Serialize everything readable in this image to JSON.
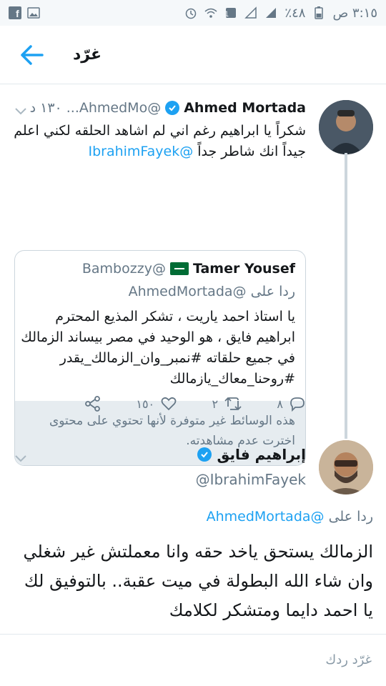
{
  "statusbar": {
    "time": "٣:١٥ ص",
    "battery": "٤٨٪"
  },
  "appbar": {
    "title": "غرّد"
  },
  "tweet1": {
    "name": "Ahmed Mortada",
    "handle": "@AhmedMo...",
    "time": "١٣٠ د",
    "text_line1": "شكراً يا ابراهيم رغم اني لم اشاهد الحلقه لكني اعلم",
    "text_line2": "جيداً انك شاطر جداً",
    "mention": "@IbrahimFayek",
    "quote": {
      "name": "Tamer Yousef",
      "handle": "@Bambozzy",
      "reply_prefix": "ردا على",
      "reply_to": "@AhmedMortada",
      "text": "يا استاذ احمد ياريت ، تشكر المذيع المحترم ابراهيم فايق ، هو الوحيد في مصر بيساند الزمالك في جميع حلقاته #نمبر_وان_الزمالك_يقدر #روحنا_معاك_يازمالك",
      "media_notice": "هذه الوسائط غير متوفرة لأنها تحتوي على محتوى اخترت عدم مشاهدته."
    },
    "actions": {
      "replies": "٨",
      "retweets": "٢",
      "likes": "١٥٠"
    }
  },
  "tweet2": {
    "name": "إبراهيم فايق",
    "handle": "@IbrahimFayek",
    "reply_prefix": "ردا على",
    "reply_to": "@AhmedMortada",
    "text": "الزمالك يستحق ياخد حقه وانا معملتش غير شغلي وان شاء الله البطولة في ميت عقبة.. بالتوفيق لك يا احمد دايما ومتشكر لكلامك"
  },
  "reply_box": {
    "placeholder": "غرّد ردك"
  },
  "colors": {
    "accent": "#1da1f2",
    "secondary_text": "#657786",
    "border": "#e1e8ed"
  },
  "icons": [
    "facebook-icon",
    "image-icon",
    "alarm-icon",
    "wifi-icon",
    "notification-icon",
    "signal-icon",
    "battery-icon",
    "back-arrow-icon",
    "chevron-down-icon",
    "verified-icon",
    "reply-icon",
    "retweet-icon",
    "like-icon",
    "share-icon"
  ]
}
